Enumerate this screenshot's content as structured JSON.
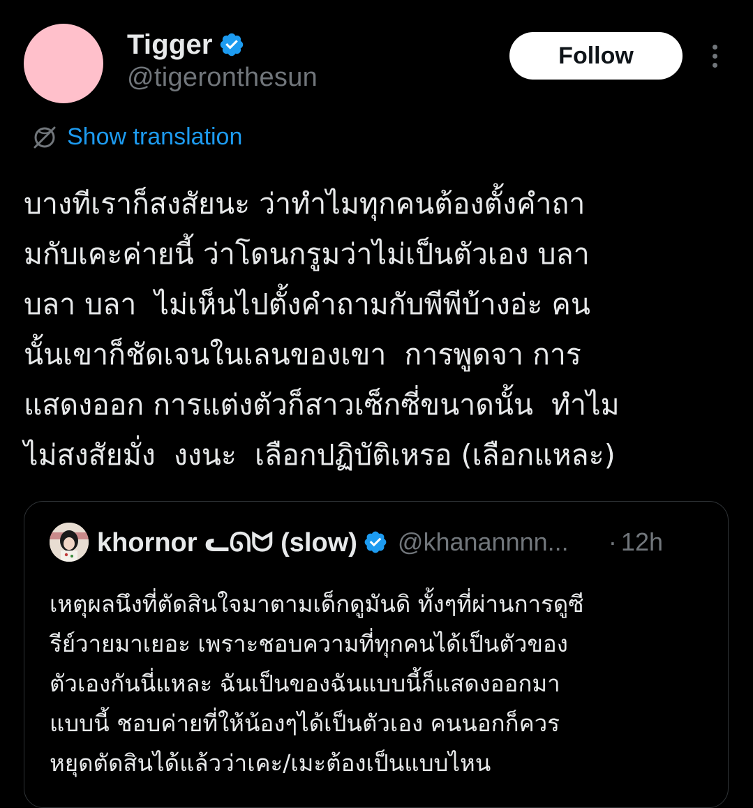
{
  "colors": {
    "background": "#000000",
    "text_primary": "#e7e9ea",
    "text_secondary": "#71767b",
    "accent": "#1d9bf0",
    "avatar": "#ffc0cb",
    "border": "#2f3336"
  },
  "author": {
    "name": "Tigger",
    "handle": "@tigeronthesun",
    "verified_icon": "verified-badge-icon",
    "avatar_icon": "avatar-pink-circle"
  },
  "actions": {
    "follow_label": "Follow",
    "more_icon": "more-vertical-icon"
  },
  "translation": {
    "label": "Show translation",
    "icon": "translate-globe-icon"
  },
  "post": {
    "lines": [
      "บางทีเราก็สงสัยนะ ว่าทำไมทุกคนต้องตั้งคำถา",
      "มกับเคะค่ายนี้ ว่าโดนกรูมว่าไม่เป็นตัวเอง บลา",
      "บลา บลา  ไม่เห็นไปตั้งคำถามกับพีพีบ้างอ่ะ คน",
      "นั้นเขาก็ชัดเจนในเลนของเขา  การพูดจา การ",
      "แสดงออก การแต่งตัวก็สาวเซ็กซี่ขนาดนั้น  ทำไม",
      "ไม่สงสัยมั่ง  งงนะ  เลือกปฏิบัติเหรอ (เลือกแหละ)"
    ]
  },
  "quote": {
    "name": "khornor ᓚᘏᗢ (slow)",
    "name_display": "khornor ᓚᘏᗢ (slow)",
    "handle": "@khanannnn...",
    "separator": "·",
    "time": "12h",
    "verified_icon": "verified-badge-icon",
    "lines": [
      "เหตุผลนึงที่ตัดสินใจมาตามเด็กดูมันดิ ทั้งๆที่ผ่านการดูซี",
      "รีย์วายมาเยอะ เพราะชอบความที่ทุกคนได้เป็นตัวของ",
      "ตัวเองกันนี่แหละ ฉันเป็นของฉันแบบนี้ก็แสดงออกมา",
      "แบบนี้ ชอบค่ายที่ให้น้องๆได้เป็นตัวเอง คนนอกก็ควร",
      "หยุดตัดสินได้แล้วว่าเคะ/เมะต้องเป็นแบบไหน"
    ]
  }
}
